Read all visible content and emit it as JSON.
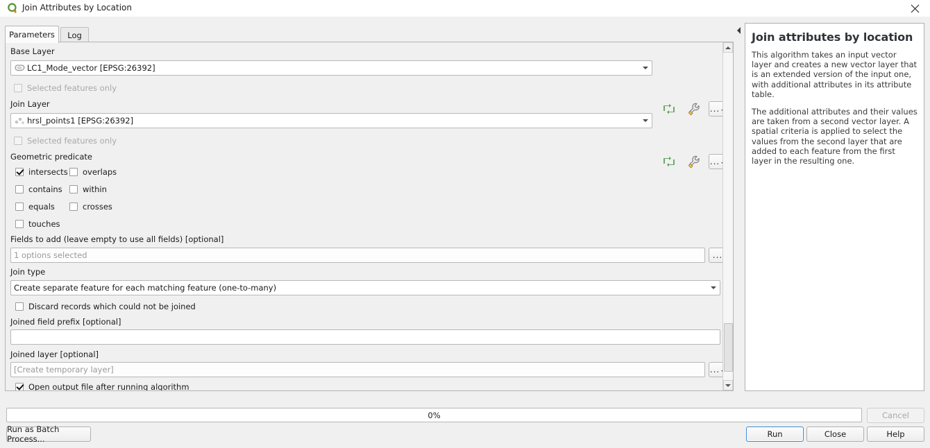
{
  "window": {
    "title": "Join Attributes by Location",
    "logo_icon": "qgis-logo-icon",
    "close_icon": "close-icon"
  },
  "tabs": [
    {
      "label": "Parameters",
      "name": "tab-parameters",
      "active": true
    },
    {
      "label": "Log",
      "name": "tab-log",
      "active": false
    }
  ],
  "parameters": {
    "base_layer": {
      "label": "Base Layer",
      "value": "LC1_Mode_vector [EPSG:26392]",
      "icon": "polygon-layer-icon",
      "selected_only_label": "Selected features only",
      "selected_only_checked": false,
      "selected_only_enabled": false,
      "iterate_icon": "iterate-refresh-icon",
      "advanced_icon": "wrench-icon",
      "browse_label": "..."
    },
    "join_layer": {
      "label": "Join Layer",
      "value": "hrsl_points1 [EPSG:26392]",
      "icon": "point-layer-icon",
      "selected_only_label": "Selected features only",
      "selected_only_checked": false,
      "selected_only_enabled": false,
      "iterate_icon": "iterate-refresh-icon",
      "advanced_icon": "wrench-icon",
      "browse_label": "..."
    },
    "geometric_predicate": {
      "label": "Geometric predicate",
      "options": [
        {
          "label": "intersects",
          "checked": true,
          "col": 0,
          "row": 0
        },
        {
          "label": "overlaps",
          "checked": false,
          "col": 1,
          "row": 0
        },
        {
          "label": "contains",
          "checked": false,
          "col": 0,
          "row": 1
        },
        {
          "label": "within",
          "checked": false,
          "col": 1,
          "row": 1
        },
        {
          "label": "equals",
          "checked": false,
          "col": 0,
          "row": 2
        },
        {
          "label": "crosses",
          "checked": false,
          "col": 1,
          "row": 2
        },
        {
          "label": "touches",
          "checked": false,
          "col": 0,
          "row": 3
        }
      ]
    },
    "fields_to_add": {
      "label": "Fields to add (leave empty to use all fields) [optional]",
      "value": "1 options selected",
      "browse_label": "..."
    },
    "join_type": {
      "label": "Join type",
      "value": "Create separate feature for each matching feature (one-to-many)"
    },
    "discard_records": {
      "label": "Discard records which could not be joined",
      "checked": false
    },
    "joined_field_prefix": {
      "label": "Joined field prefix [optional]",
      "value": ""
    },
    "joined_layer": {
      "label": "Joined layer [optional]",
      "placeholder": "[Create temporary layer]",
      "value": "",
      "browse_label": "..."
    },
    "open_output": {
      "label": "Open output file after running algorithm",
      "checked": true
    }
  },
  "collapse_handle_icon": "collapse-left-icon",
  "help": {
    "title": "Join attributes by location",
    "paragraphs": [
      "This algorithm takes an input vector layer and creates a new vector layer that is an extended version of the input one, with additional attributes in its attribute table.",
      "The additional attributes and their values are taken from a second vector layer. A spatial criteria is applied to select the values from the second layer that are added to each feature from the first layer in the resulting one."
    ]
  },
  "footer": {
    "progress_text": "0%",
    "progress_percent": 0,
    "run_batch_label": "Run as Batch Process...",
    "cancel_label": "Cancel",
    "cancel_enabled": false,
    "run_label": "Run",
    "close_label": "Close",
    "help_label": "Help"
  },
  "colors": {
    "window_bg": "#f0f0f0",
    "field_bg": "#ffffff",
    "accent_blue": "#3d8bd8",
    "icon_green": "#6aa86a",
    "logo_green": "#589632",
    "logo_orange": "#e08214",
    "disabled_text": "#a8a8a8"
  }
}
